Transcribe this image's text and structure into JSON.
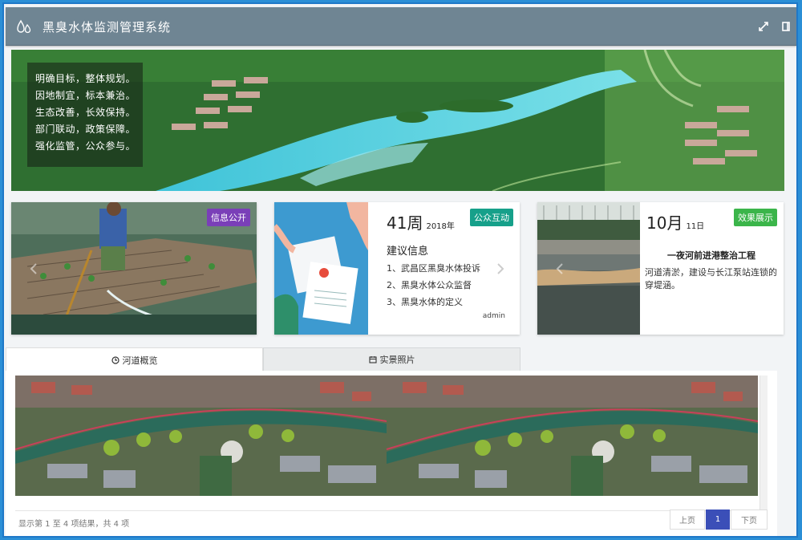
{
  "header": {
    "title": "黑臭水体监测管理系统",
    "icons": [
      "water-drops-icon",
      "expand-icon",
      "fullscreen-icon"
    ]
  },
  "banner": {
    "slogans": [
      "明确目标，整体规划。",
      "因地制宜，标本兼治。",
      "生态改善，长效保持。",
      "部门联动，政策保障。",
      "强化监管，公众参与。"
    ]
  },
  "cards": {
    "info": {
      "badge": "信息公开",
      "badge_color": "#7a3fb8"
    },
    "interact": {
      "badge": "公众互动",
      "badge_color": "#16a08a",
      "week": "41周",
      "year": "2018年",
      "title": "建议信息",
      "items": [
        "1、武昌区黑臭水体投诉",
        "2、黑臭水体公众监督",
        "3、黑臭水体的定义"
      ],
      "author": "admin"
    },
    "effect": {
      "badge": "效果展示",
      "badge_color": "#3bb54a",
      "month": "10月",
      "day": "11日",
      "title": "一夜河前进港整治工程",
      "text": "河道清淤，建设与长江泵站连锁的穿堤涵。"
    }
  },
  "tabs": [
    {
      "label": "河道概览",
      "icon": "clock-icon"
    },
    {
      "label": "实景照片",
      "icon": "calendar-icon"
    }
  ],
  "table": {
    "info": "显示第 1 至 4 项结果，共 4 项",
    "prev": "上页",
    "page": "1",
    "next": "下页"
  }
}
